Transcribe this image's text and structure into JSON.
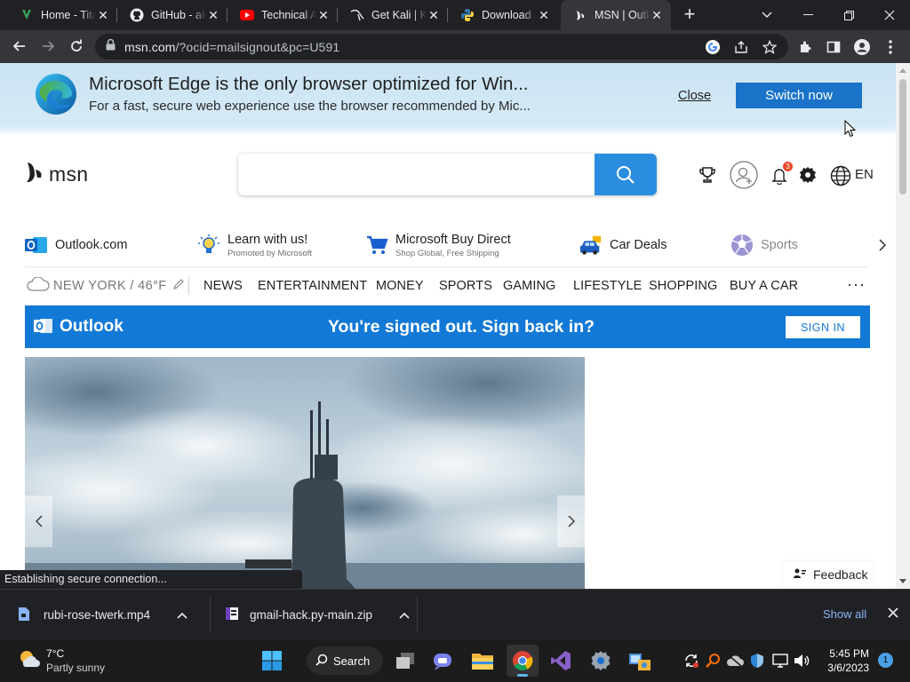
{
  "browser": {
    "tabs": [
      {
        "title": "Home - Tita",
        "icon": "titan-leaf-icon"
      },
      {
        "title": "GitHub - ak",
        "icon": "github-icon"
      },
      {
        "title": "Technical A",
        "icon": "youtube-icon"
      },
      {
        "title": "Get Kali | K",
        "icon": "kali-dragon-icon"
      },
      {
        "title": "Download",
        "icon": "python-icon"
      },
      {
        "title": "MSN | Outl",
        "icon": "msn-butterfly-icon",
        "active": true
      }
    ],
    "url_host": "msn.com",
    "url_path": "/?ocid=mailsignout&pc=U591",
    "status_text": "Establishing secure connection..."
  },
  "edge_banner": {
    "heading": "Microsoft Edge is the only browser optimized for Win...",
    "subtext": "For a fast, secure web experience use the browser recommended by Mic...",
    "close_label": "Close",
    "switch_label": "Switch now"
  },
  "msn": {
    "logo_text": "msn",
    "search_placeholder": "",
    "language": "EN",
    "notification_count": "3",
    "quick_links": [
      {
        "label": "Outlook.com",
        "sub": "",
        "icon": "outlook-icon"
      },
      {
        "label": "Learn with us!",
        "sub": "Promoted by Microsoft",
        "icon": "lightbulb-icon"
      },
      {
        "label": "Microsoft Buy Direct",
        "sub": "Shop Global, Free Shipping",
        "icon": "shopping-cart-icon"
      },
      {
        "label": "Car Deals",
        "sub": "",
        "icon": "car-icon"
      },
      {
        "label": "Sports",
        "sub": "",
        "icon": "sports-ball-icon"
      }
    ],
    "weather": "NEW YORK / 46°F",
    "nav": [
      "NEWS",
      "ENTERTAINMENT",
      "MONEY",
      "SPORTS",
      "GAMING",
      "LIFESTYLE",
      "SHOPPING",
      "BUY A CAR"
    ],
    "nav_more": "···",
    "outlook_banner": {
      "brand": "Outlook",
      "message": "You're signed out. Sign back in?",
      "button": "SIGN IN"
    },
    "feedback_label": "Feedback"
  },
  "downloads": {
    "items": [
      {
        "name": "rubi-rose-twerk.mp4",
        "icon": "video-file-icon"
      },
      {
        "name": "gmail-hack.py-main.zip",
        "icon": "zip-file-icon"
      }
    ],
    "show_all": "Show all"
  },
  "taskbar": {
    "weather_temp": "7°C",
    "weather_cond": "Partly sunny",
    "search_label": "Search",
    "time": "5:45 PM",
    "date": "3/6/2023",
    "notification_count": "1"
  },
  "colors": {
    "msn_blue": "#1279d6",
    "edge_switch": "#1a73c8",
    "search_button": "#2b8de0",
    "chrome_dark": "#202124"
  }
}
